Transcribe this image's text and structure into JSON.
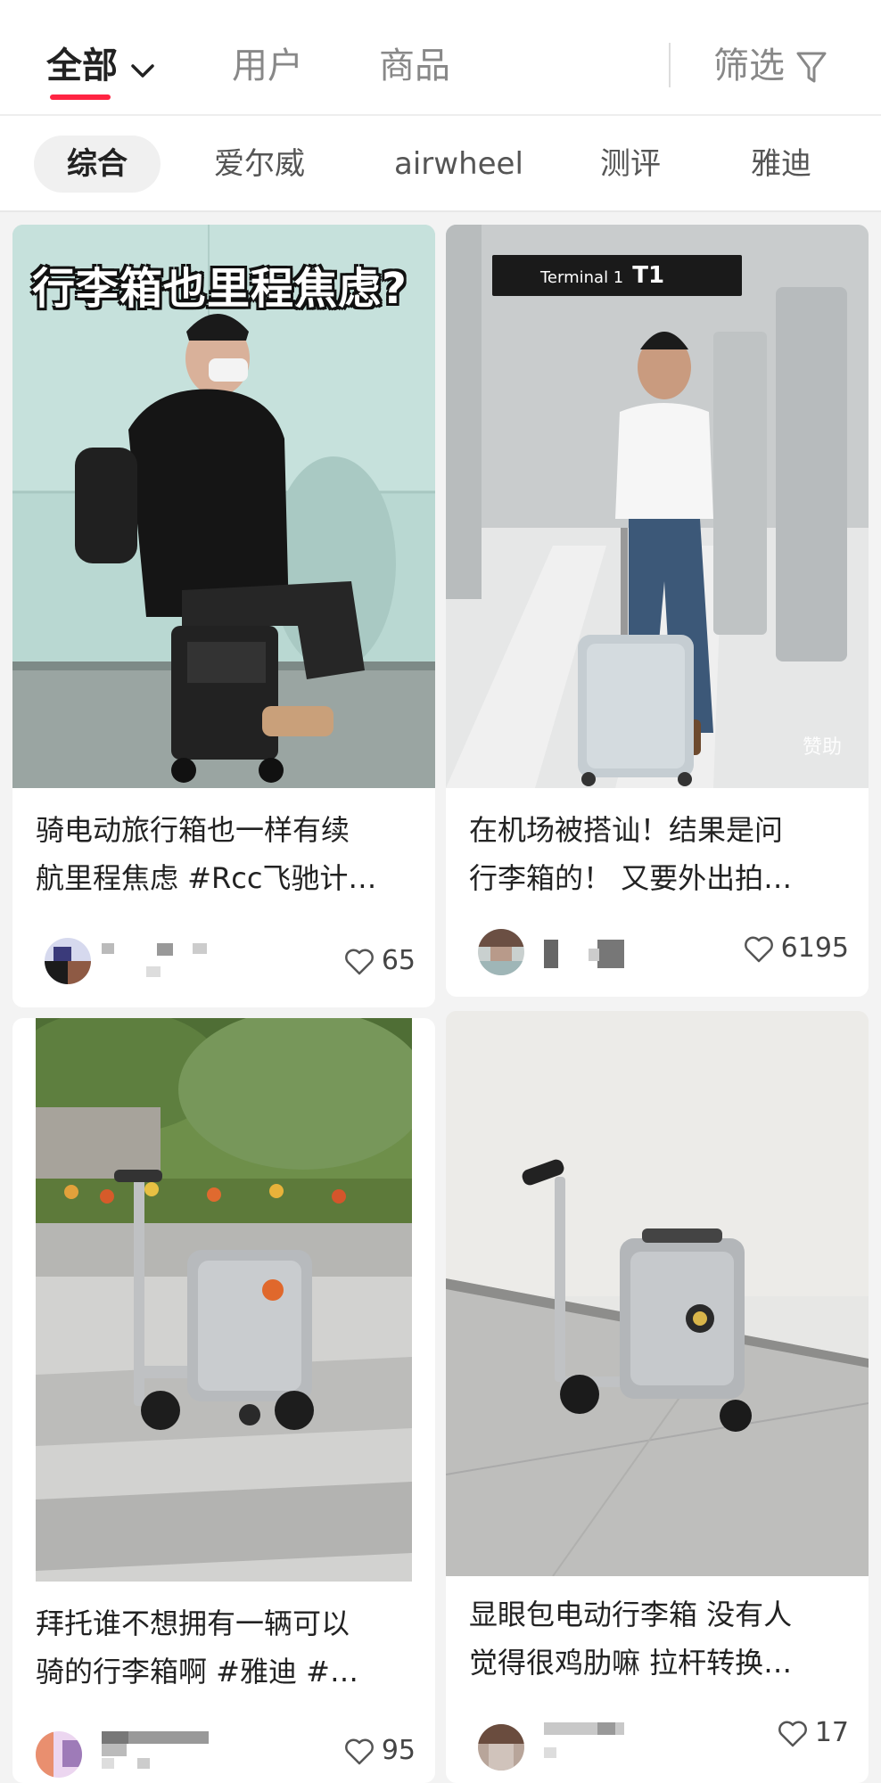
{
  "tabs": {
    "all": "全部",
    "users": "用户",
    "goods": "商品",
    "filter": "筛选"
  },
  "chips": [
    "综合",
    "爱尔威",
    "airwheel",
    "测评",
    "雅迪"
  ],
  "cards": [
    {
      "image_caption": "行李箱也里程焦虑?",
      "title_line1": "骑电动旅行箱也一样有续",
      "title_line2": "航里程焦虑 #Rcc飞驰计…",
      "likes": "65"
    },
    {
      "sign_text": "Terminal 1",
      "sign_code": "T1",
      "sponsor": "赞助",
      "title_line1": "在机场被搭讪！结果是问",
      "title_line2": "行李箱的！ 又要外出拍…",
      "likes": "6195"
    },
    {
      "title_line1": "拜托谁不想拥有一辆可以",
      "title_line2": "骑的行李箱啊 #雅迪  #…",
      "likes": "95"
    },
    {
      "title_line1": "显眼包电动行李箱 没有人",
      "title_line2": "觉得很鸡肋嘛 拉杆转换…",
      "likes": "17"
    }
  ],
  "colors": {
    "accent": "#ff2442",
    "background": "#f3f3f3"
  }
}
